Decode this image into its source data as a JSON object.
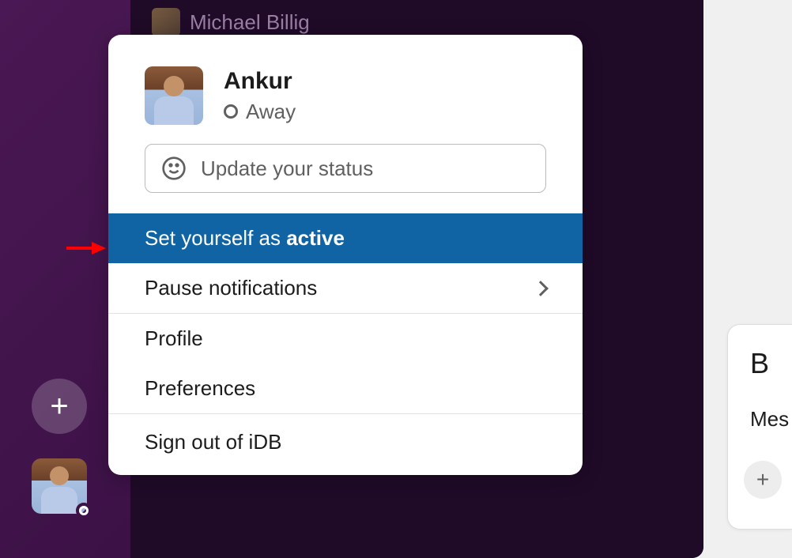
{
  "sidebar": {
    "member_behind": "Michael Billig",
    "add_button_label": "+"
  },
  "popup": {
    "user_name": "Ankur",
    "presence_label": "Away",
    "status_placeholder": "Update your status",
    "set_active_prefix": "Set yourself as ",
    "set_active_bold": "active",
    "pause_notifications": "Pause notifications",
    "profile": "Profile",
    "preferences": "Preferences",
    "sign_out": "Sign out of iDB"
  },
  "right_panel": {
    "letter": "B",
    "mes_text": "Mes",
    "add_label": "+"
  }
}
